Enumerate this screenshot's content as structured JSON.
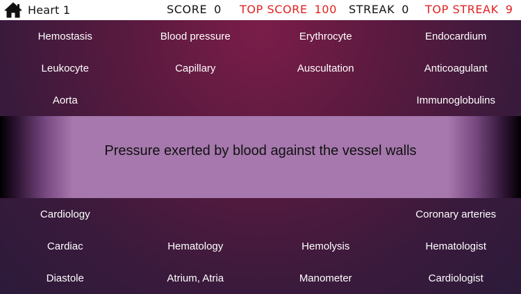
{
  "header": {
    "level_title": "Heart 1",
    "score_label": "SCORE",
    "score_value": "0",
    "top_score_label": "TOP SCORE",
    "top_score_value": "100",
    "streak_label": "STREAK",
    "streak_value": "0",
    "top_streak_label": "TOP STREAK",
    "top_streak_value": "9",
    "home_icon": "home-icon"
  },
  "colors": {
    "accent_red": "#e0211f",
    "clue_band": "#a678ad",
    "background": "#5a1a3f"
  },
  "clue": {
    "text": "Pressure exerted by blood against the vessel walls"
  },
  "top_terms": [
    [
      "Hemostasis",
      "Blood pressure",
      "Erythrocyte",
      "Endocardium"
    ],
    [
      "Leukocyte",
      "Capillary",
      "Auscultation",
      "Anticoagulant"
    ],
    [
      "Aorta",
      "",
      "",
      "Immunoglobulins"
    ]
  ],
  "bottom_terms": [
    [
      "Cardiology",
      "",
      "",
      "Coronary arteries"
    ],
    [
      "Cardiac",
      "Hematology",
      "Hemolysis",
      "Hematologist"
    ],
    [
      "Diastole",
      "Atrium, Atria",
      "Manometer",
      "Cardiologist"
    ]
  ]
}
